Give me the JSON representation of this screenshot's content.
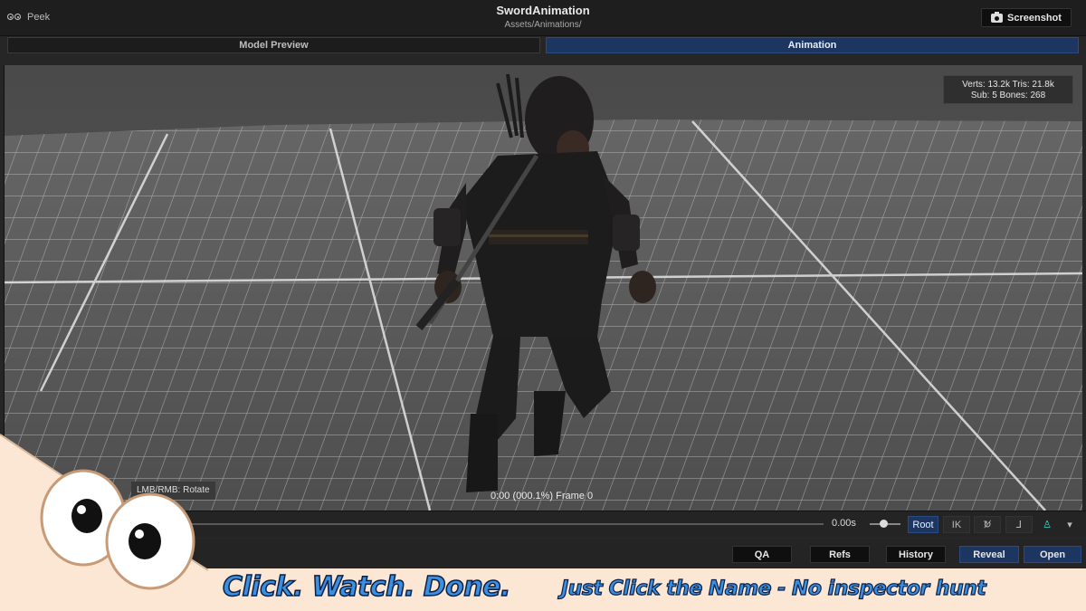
{
  "window": {
    "app_label": "Peek",
    "title": "SwordAnimation",
    "path": "Assets/Animations/",
    "screenshot_label": "Screenshot"
  },
  "tabs": [
    {
      "label": "Model Preview",
      "active": false
    },
    {
      "label": "Animation",
      "active": true
    }
  ],
  "viewport": {
    "stats_line1": "Verts: 13.2k  Tris: 21.8k",
    "stats_line2": "Sub: 5  Bones: 268",
    "hint": "LMB/RMB: Rotate",
    "frame_readout": "0:00 (000.1%) Frame 0"
  },
  "timeline": {
    "time": "0.00s",
    "root_label": "Root",
    "ik_label": "IK",
    "noloop_symbol": "↻̸",
    "bones_symbol": "⅃",
    "humanoid_symbol": "♙",
    "more_symbol": "▾"
  },
  "actions": {
    "qa": "QA",
    "refs": "Refs",
    "history": "History",
    "reveal": "Reveal",
    "open": "Open"
  },
  "banner": {
    "slogan": "Click. Watch. Done.",
    "tagline": "Just Click the Name - No inspector hunt"
  },
  "colors": {
    "accent_blue": "#1d3561",
    "banner_text": "#3a8fe0",
    "humanoid_teal": "#2ee6c6"
  }
}
